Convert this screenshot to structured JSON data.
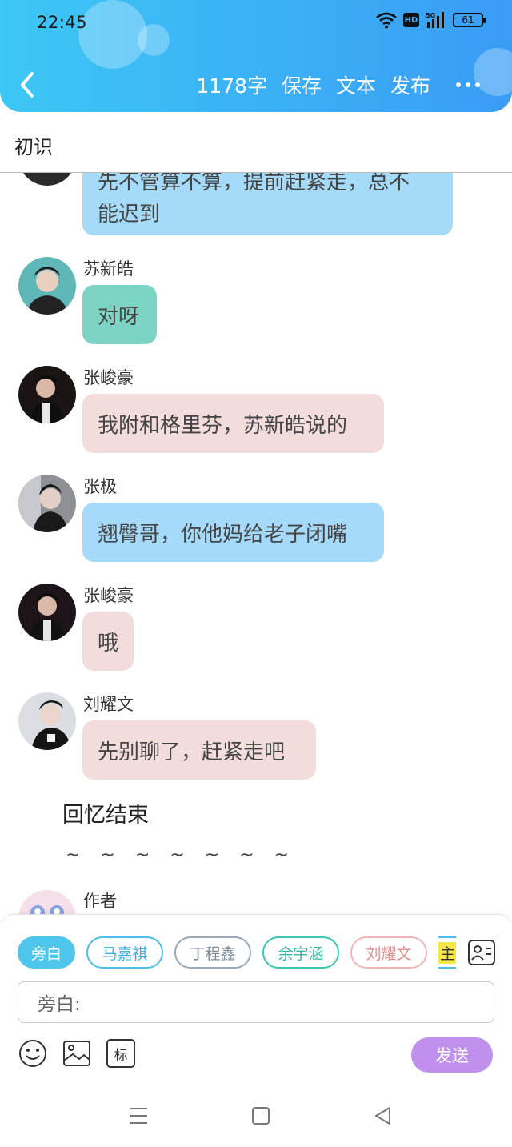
{
  "status_bar": {
    "time": "22:45",
    "network_badge": "HD",
    "signal_label": "5G",
    "battery": "61"
  },
  "toolbar": {
    "word_count": "1178字",
    "save_label": "保存",
    "text_label": "文本",
    "publish_label": "发布"
  },
  "page_title": "初识",
  "messages": [
    {
      "name": "",
      "text": "先不管算不算，提前赶紧走，总不",
      "text2": "能迟到",
      "color": "#a5daf8"
    },
    {
      "name": "苏新皓",
      "text": "对呀",
      "color": "#7dd4c4"
    },
    {
      "name": "张峻豪",
      "text": "我附和格里芬，苏新皓说的",
      "color": "#f2dcdc"
    },
    {
      "name": "张极",
      "text": "翘臀哥，你他妈给老子闭嘴",
      "color": "#a6dafa"
    },
    {
      "name": "张峻豪",
      "text": "哦",
      "color": "#f2dcdc"
    },
    {
      "name": "刘耀文",
      "text": "先别聊了，赶紧走吧",
      "color": "#f2dcdc"
    }
  ],
  "narration": "回忆结束",
  "tilde_line": "~ ~ ~ ~ ~ ~ ~",
  "partial_author": "作者",
  "role_chips": [
    {
      "label": "旁白",
      "border": "#4ec6ec",
      "bg": "#4ec6ec",
      "text": "#ffffff"
    },
    {
      "label": "马嘉祺",
      "border": "#4dbfe6",
      "bg": "#ffffff",
      "text": "#3fb2dc"
    },
    {
      "label": "丁程鑫",
      "border": "#9aa8b8",
      "bg": "#ffffff",
      "text": "#7d8b9b"
    },
    {
      "label": "余宇涵",
      "border": "#3cc8b0",
      "bg": "#ffffff",
      "text": "#2fb89f"
    },
    {
      "label": "刘耀文",
      "border": "#eeb7b7",
      "bg": "#ffffff",
      "text": "#e08e8e"
    },
    {
      "label": "主",
      "border": "#4dbfe6",
      "bg": "#ffffff",
      "text": "#333333"
    }
  ],
  "input": {
    "placeholder": "旁白:"
  },
  "label_button": "标",
  "send_label": "发送",
  "colors": {
    "header_start": "#3cc7f5",
    "header_end": "#3a9cf5",
    "send_button": "#c091ec"
  },
  "icons": {
    "back": "chevron-left-icon",
    "more": "more-dots-icon",
    "contacts": "contacts-icon",
    "emoji": "smiley-icon",
    "image": "image-icon",
    "nav_menu": "menu-icon",
    "nav_home": "home-square-icon",
    "nav_back": "triangle-back-icon"
  }
}
